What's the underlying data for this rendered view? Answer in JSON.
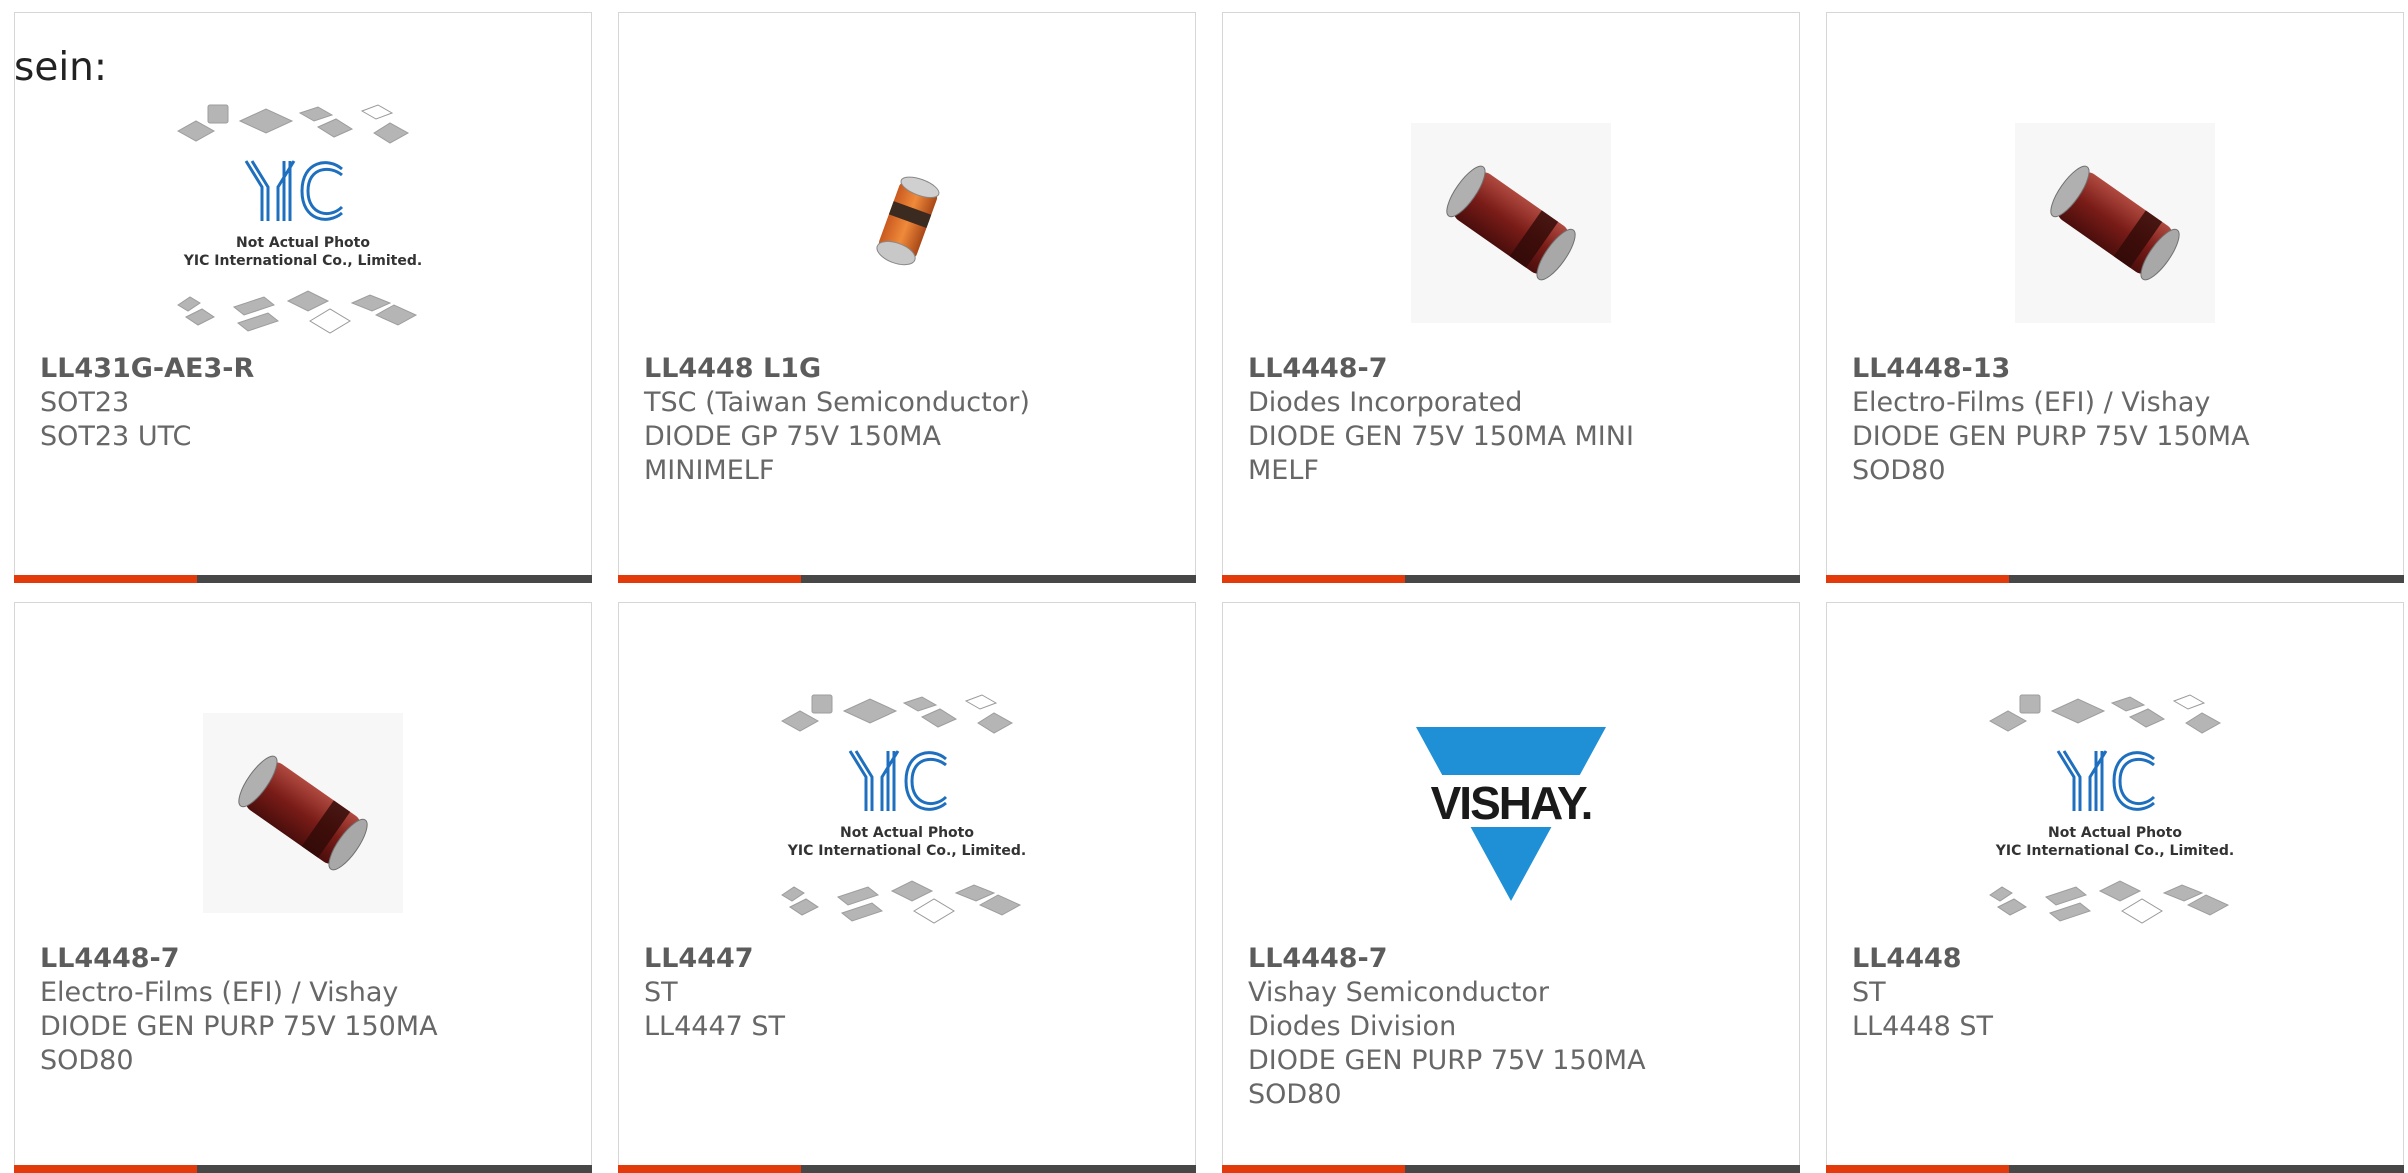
{
  "intro_text": "sein:",
  "colors": {
    "accent": "#e23a0a",
    "bar": "#474747",
    "border": "#d6d6d6",
    "text": "#676767",
    "vishay_blue": "#1f8fd6"
  },
  "products": [
    {
      "part": "LL431G-AE3-R",
      "maker": "SOT23",
      "desc": "SOT23 UTC",
      "image": "yic-placeholder",
      "photo_caption_1": "Not Actual Photo",
      "photo_caption_2": "YIC International Co., Limited."
    },
    {
      "part": "LL4448 L1G",
      "maker": "TSC (Taiwan Semiconductor)",
      "desc": "DIODE GP 75V 150MA MINIMELF",
      "image": "orange-diode"
    },
    {
      "part": "LL4448-7",
      "maker": "Diodes Incorporated",
      "desc": "DIODE GEN 75V 150MA MINI MELF",
      "image": "red-diode"
    },
    {
      "part": "LL4448-13",
      "maker": "Electro-Films (EFI) / Vishay",
      "desc": "DIODE GEN PURP 75V 150MA SOD80",
      "image": "red-diode"
    },
    {
      "part": "LL4448-7",
      "maker": "Electro-Films (EFI) / Vishay",
      "desc": "DIODE GEN PURP 75V 150MA SOD80",
      "image": "red-diode"
    },
    {
      "part": "LL4447",
      "maker": "ST",
      "desc": "LL4447 ST",
      "image": "yic-placeholder",
      "photo_caption_1": "Not Actual Photo",
      "photo_caption_2": "YIC International Co., Limited."
    },
    {
      "part": "LL4448-7",
      "maker": "Vishay Semiconductor Diodes Division",
      "desc": "DIODE GEN PURP 75V 150MA SOD80",
      "image": "vishay-logo",
      "logo_text": "VISHAY."
    },
    {
      "part": "LL4448",
      "maker": "ST",
      "desc": "LL4448 ST",
      "image": "yic-placeholder",
      "photo_caption_1": "Not Actual Photo",
      "photo_caption_2": "YIC International Co., Limited."
    }
  ]
}
